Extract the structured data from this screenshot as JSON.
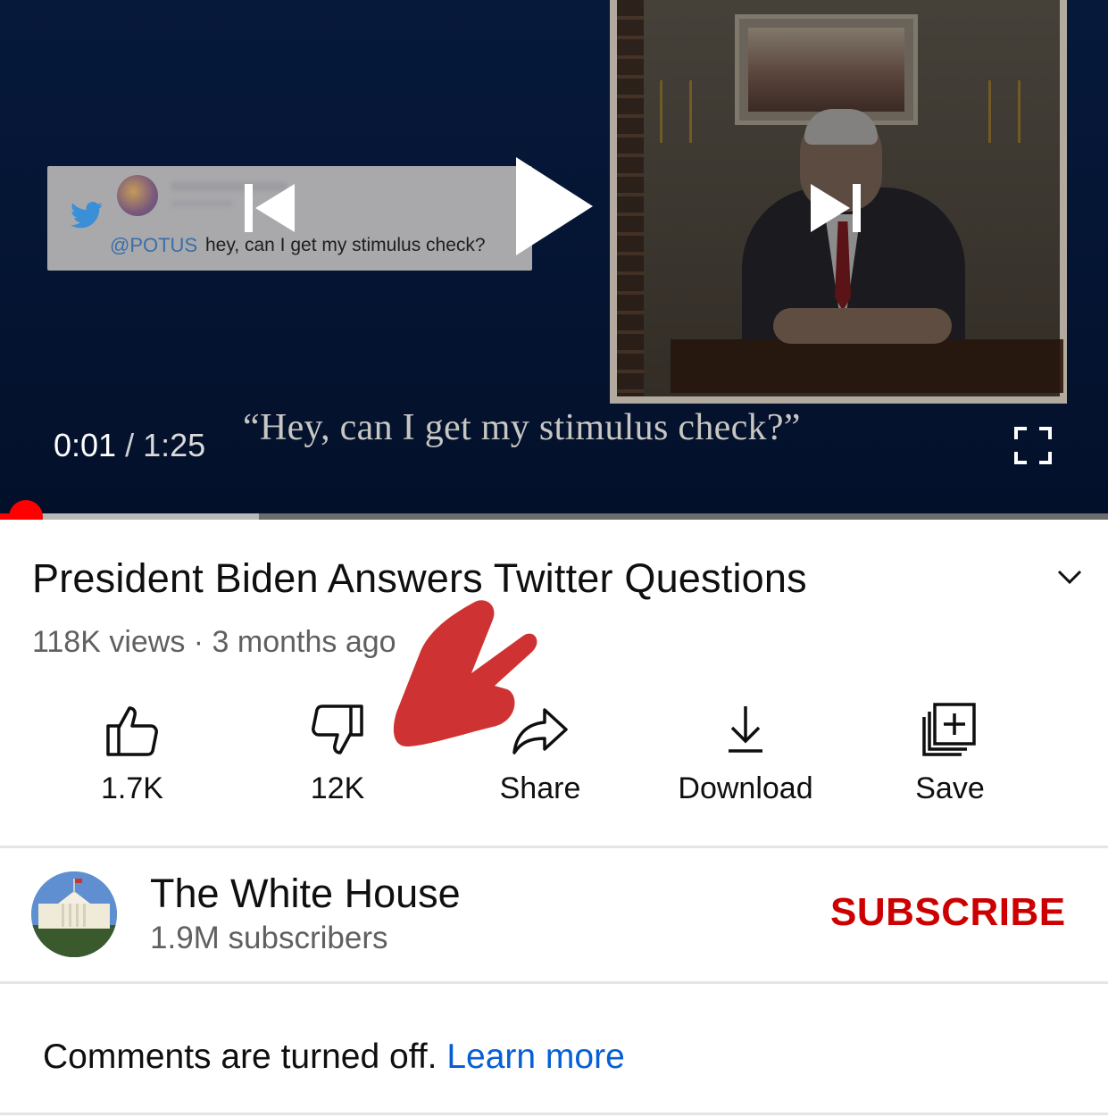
{
  "player": {
    "tweet": {
      "handle": "@POTUS",
      "text": "hey, can I get my stimulus check?"
    },
    "caption_quote": "“Hey, can I get my stimulus check?”",
    "current_time": "0:01",
    "separator": "/",
    "duration": "1:25",
    "progress": {
      "played_fraction": 0.02,
      "buffered_fraction": 0.234
    },
    "controls": {
      "previous_icon": "skip-previous-icon",
      "play_icon": "play-icon",
      "next_icon": "skip-next-icon",
      "fullscreen_icon": "fullscreen-icon"
    }
  },
  "video": {
    "title": "President Biden Answers Twitter Questions",
    "meta": "118K views · 3 months ago",
    "expand_icon": "chevron-down-icon"
  },
  "actions": [
    {
      "label": "1.7K",
      "icon": "thumbs-up-icon"
    },
    {
      "label": "12K",
      "icon": "thumbs-down-icon"
    },
    {
      "label": "Share",
      "icon": "share-icon"
    },
    {
      "label": "Download",
      "icon": "download-icon"
    },
    {
      "label": "Save",
      "icon": "save-playlist-icon"
    }
  ],
  "channel": {
    "name": "The White House",
    "subscribers": "1.9M subscribers",
    "subscribe_label": "SUBSCRIBE"
  },
  "comments": {
    "text": "Comments are turned off.",
    "link": "Learn more"
  },
  "colors": {
    "accent_red": "#ff0000",
    "subscribe_red": "#cc0000",
    "link_blue": "#065fd4",
    "annotation_arrow": "#cf3232"
  }
}
